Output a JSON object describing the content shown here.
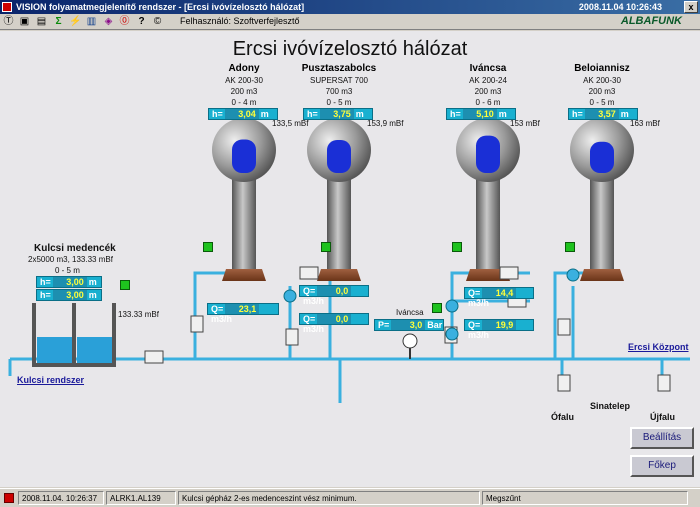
{
  "window": {
    "title": "VISION folyamatmegjelenítő rendszer - [Ercsi ivóvízelosztó hálózat]",
    "clock": "2008.11.04 10:26:43",
    "close": "x"
  },
  "toolbar": {
    "icons": [
      "Ⓣ",
      "▣",
      "▤",
      "Σ",
      "⚡",
      "▥",
      "◈",
      "⓪",
      "?",
      "©"
    ],
    "user": "Felhasználó: Szoftverfejlesztő",
    "brand": "ALBAFUNK"
  },
  "page": {
    "title": "Ercsi ivóvízelosztó hálózat"
  },
  "towers": [
    {
      "name": "Adony",
      "model": "AK 200-30",
      "volume": "200 m3",
      "range": "0 - 4 m",
      "h_label": "h=",
      "h_value": "3,04",
      "unit": "m",
      "mbf": "133,5 mBf",
      "level": 0.76
    },
    {
      "name": "Pusztaszabolcs",
      "model": "SUPERSAT 700",
      "volume": "700 m3",
      "range": "0 - 5 m",
      "h_label": "h=",
      "h_value": "3,75",
      "unit": "m",
      "mbf": "153,9 mBf",
      "level": 0.75
    },
    {
      "name": "Iváncsa",
      "model": "AK 200-24",
      "volume": "200 m3",
      "range": "0 - 6 m",
      "h_label": "h=",
      "h_value": "5,10",
      "unit": "m",
      "mbf": "153 mBf",
      "level": 0.85
    },
    {
      "name": "Beloiannisz",
      "model": "AK 200-30",
      "volume": "200 m3",
      "range": "0 - 5 m",
      "h_label": "h=",
      "h_value": "3,57",
      "unit": "m",
      "mbf": "163 mBf",
      "level": 0.71
    }
  ],
  "reservoir": {
    "name": "Kulcsi medencék",
    "spec": "2x5000 m3, 133.33 mBf",
    "range": "0 - 5 m",
    "h1_label": "h=",
    "h1_value": "3,00",
    "h2_label": "h=",
    "h2_value": "3,00",
    "unit": "m",
    "mbf": "133.33 mBf"
  },
  "flows": [
    {
      "label": "Q=",
      "value": "23,1",
      "unit": "m3/h"
    },
    {
      "label": "Q=",
      "value": "0,0",
      "unit": "m3/h"
    },
    {
      "label": "Q=",
      "value": "0,0",
      "unit": "m3/h"
    },
    {
      "label": "Q=",
      "value": "14,4",
      "unit": "m3/h"
    },
    {
      "label": "Q=",
      "value": "19,9",
      "unit": "m3/h"
    }
  ],
  "pressure": {
    "site": "Iváncsa",
    "label": "P=",
    "value": "3,0",
    "unit": "Bar"
  },
  "links": {
    "kulcsi": "Kulcsi rendszer",
    "ercsi": "Ercsi Központ"
  },
  "places": {
    "ofalu": "Ófalu",
    "sinatelep": "Sinatelep",
    "ujfalu": "Újfalu"
  },
  "buttons": {
    "settings": "Beállítás",
    "main": "Főkep"
  },
  "status": {
    "time": "2008.11.04. 10:26:37",
    "code": "ALRK1.AL139",
    "message": "Kulcsi gépház 2-es medenceszint vész minimum.",
    "state": "Megszűnt"
  },
  "colors": {
    "water": "#1a2fd6",
    "pipe": "#3ab0df",
    "accent": "#19b0d0"
  }
}
